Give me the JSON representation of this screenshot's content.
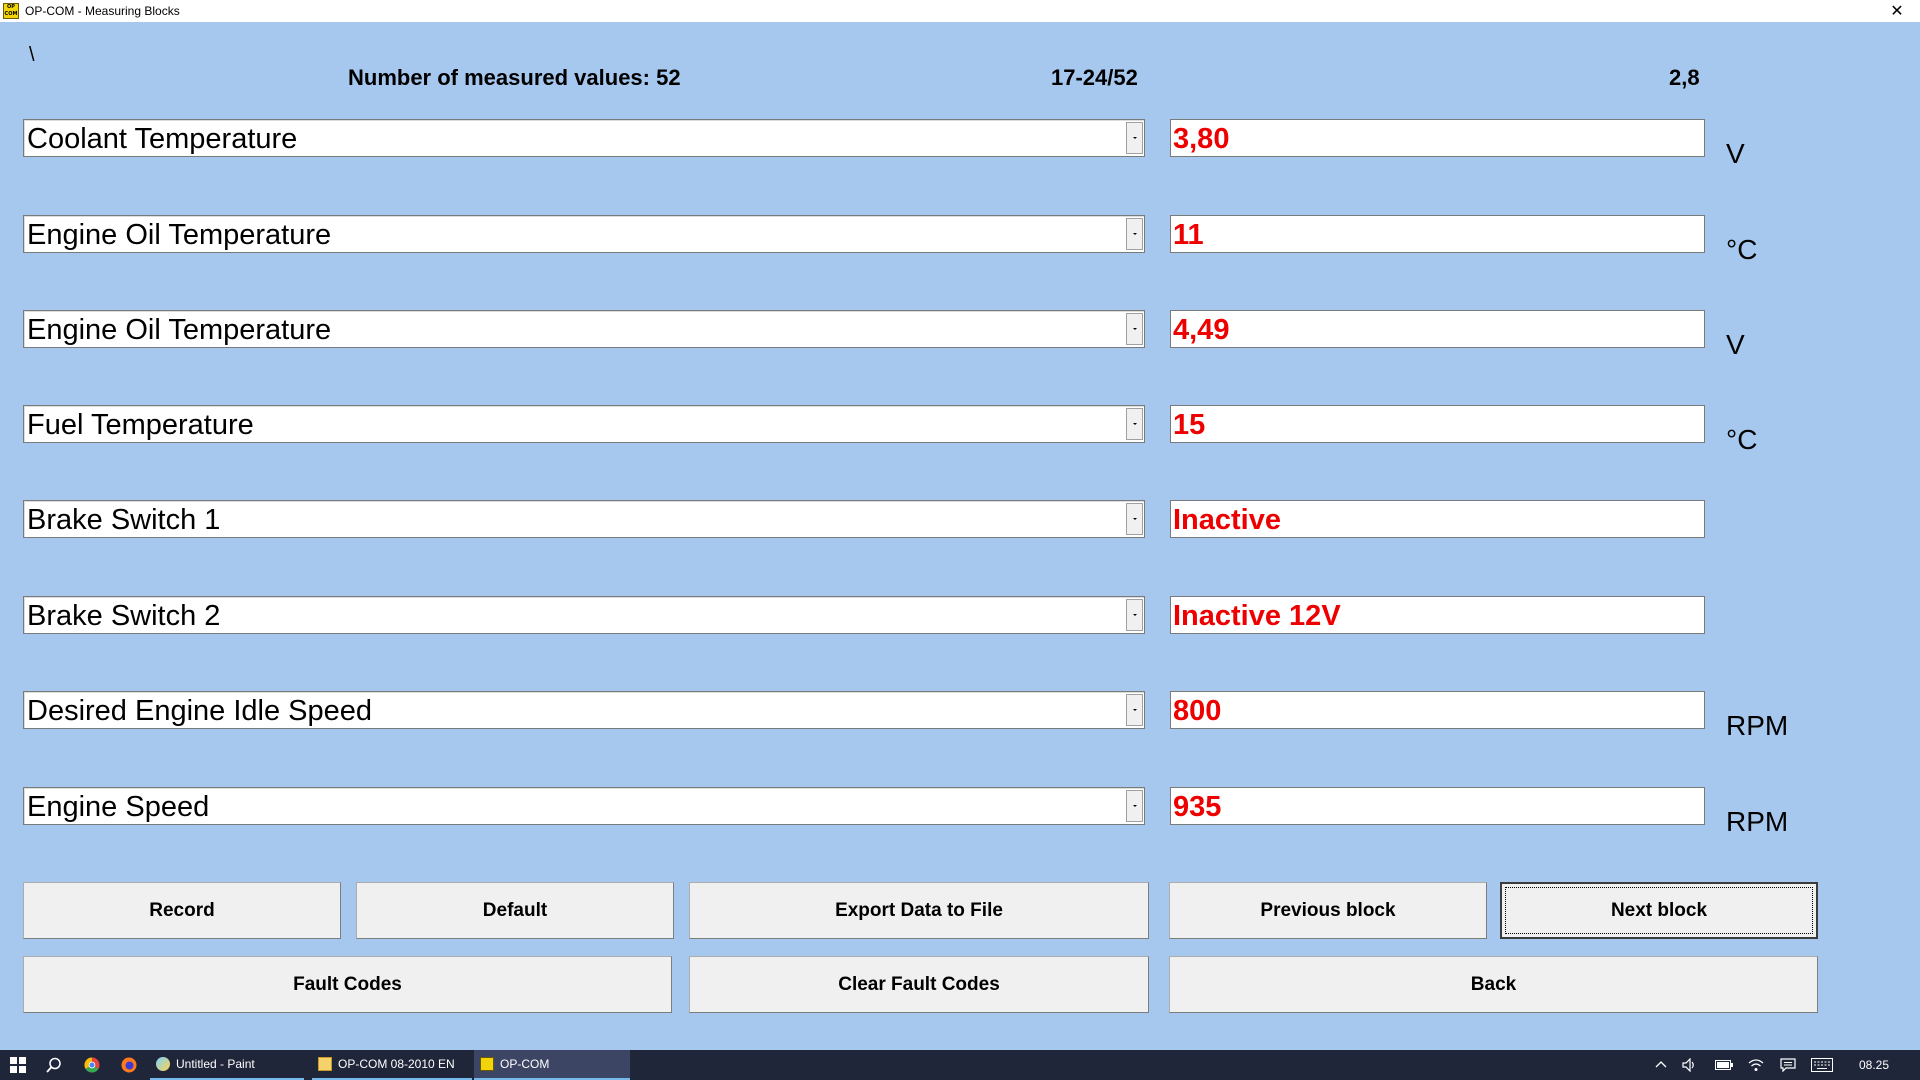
{
  "window": {
    "title": "OP-COM - Measuring Blocks",
    "app_icon_text": "OP COM",
    "close_glyph": "✕"
  },
  "header": {
    "backslash": "\\",
    "count_text": "Number of measured values: 52",
    "range_text": "17-24/52",
    "zoom_text": "2,8"
  },
  "rows": [
    {
      "name": "Coolant Temperature",
      "value": "3,80",
      "unit": "V"
    },
    {
      "name": "Engine Oil Temperature",
      "value": "11",
      "unit": "°C"
    },
    {
      "name": "Engine Oil Temperature",
      "value": "4,49",
      "unit": "V"
    },
    {
      "name": "Fuel Temperature",
      "value": "15",
      "unit": "°C"
    },
    {
      "name": "Brake Switch 1",
      "value": "Inactive",
      "unit": ""
    },
    {
      "name": "Brake Switch 2",
      "value": "Inactive 12V",
      "unit": ""
    },
    {
      "name": "Desired Engine Idle Speed",
      "value": "800",
      "unit": "RPM"
    },
    {
      "name": "Engine Speed",
      "value": "935",
      "unit": "RPM"
    }
  ],
  "buttons": {
    "record": "Record",
    "default": "Default",
    "export": "Export Data to File",
    "previous": "Previous block",
    "next": "Next block",
    "fault_codes": "Fault Codes",
    "clear_fault_codes": "Clear Fault Codes",
    "back": "Back"
  },
  "taskbar": {
    "items": [
      {
        "label": "Untitled - Paint"
      },
      {
        "label": "OP-COM 08-2010 EN"
      },
      {
        "label": "OP-COM"
      }
    ],
    "clock": "08.25"
  },
  "colors": {
    "background": "#a6c8ef",
    "value_text": "#ee0000",
    "taskbar": "#20263a"
  }
}
